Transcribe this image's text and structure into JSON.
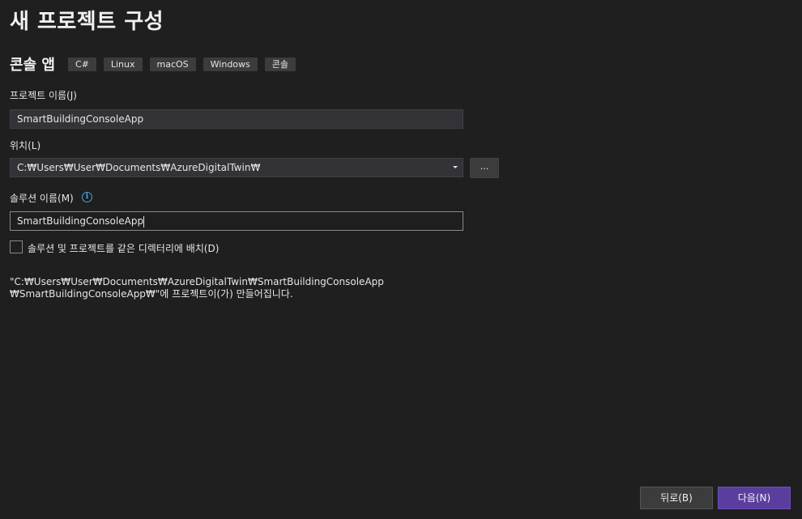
{
  "page": {
    "title": "새 프로젝트 구성"
  },
  "template": {
    "name": "콘솔 앱",
    "tags": [
      "C#",
      "Linux",
      "macOS",
      "Windows",
      "콘솔"
    ]
  },
  "project_name": {
    "label": "프로젝트 이름(J)",
    "value": "SmartBuildingConsoleApp"
  },
  "location": {
    "label": "위치(L)",
    "value": "C:₩Users₩User₩Documents₩AzureDigitalTwin₩",
    "browse_label": "..."
  },
  "solution_name": {
    "label": "솔루션 이름(M)",
    "info_icon": "info-icon",
    "value": "SmartBuildingConsoleApp"
  },
  "same_directory": {
    "label": "솔루션 및 프로젝트를 같은 디렉터리에 배치(D)",
    "checked": false
  },
  "path_info": {
    "line1": "\"C:₩Users₩User₩Documents₩AzureDigitalTwin₩SmartBuildingConsoleApp",
    "line2": "₩SmartBuildingConsoleApp₩\"에 프로젝트이(가) 만들어집니다."
  },
  "buttons": {
    "back": "뒤로(B)",
    "next": "다음(N)"
  },
  "colors": {
    "background": "#1f1f1f",
    "primary_button": "#5a3e9e",
    "info_icon": "#4aa3df"
  }
}
